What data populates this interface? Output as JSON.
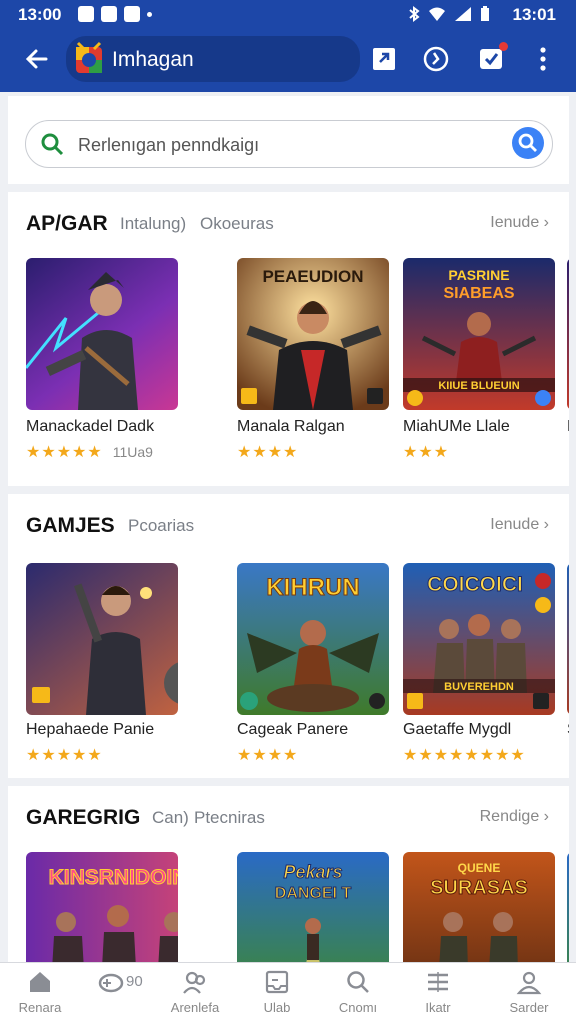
{
  "status_bar": {
    "time_left": "13:00",
    "time_right": "13:01"
  },
  "app_bar": {
    "title": "Imhagan"
  },
  "search": {
    "placeholder": "Rerlenıgan penndkaigı"
  },
  "sections": [
    {
      "title": "AP/GAR",
      "tabs": [
        "Intalung)",
        "Okoeuras"
      ],
      "more": "Ienude",
      "items": [
        {
          "name": "Manackadel Dadk",
          "stars": "★★★★★",
          "extra": "11Ua9"
        },
        {
          "name": "Manala Ralgan",
          "stars": "★★★★",
          "extra": ""
        },
        {
          "name": "MiahUMe Llale",
          "stars": "★★★",
          "extra": ""
        }
      ],
      "peek_label": "K"
    },
    {
      "title": "GAMJES",
      "tabs": [
        "Pcoarias"
      ],
      "more": "Ienude",
      "items": [
        {
          "name": "Hepahaede Panie",
          "stars": "★★★★★",
          "extra": ""
        },
        {
          "name": "Cageak Panere",
          "stars": "★★★★",
          "extra": ""
        },
        {
          "name": "Gaetaffe Mygdl",
          "stars": "★★★★★★★★",
          "extra": ""
        }
      ],
      "peek_label": "S"
    },
    {
      "title": "GAREGRIG",
      "tabs": [
        "Can)",
        "Ptecniras"
      ],
      "more": "Rendige",
      "items": [
        {
          "name": "",
          "stars": "",
          "extra": ""
        },
        {
          "name": "",
          "stars": "",
          "extra": ""
        },
        {
          "name": "",
          "stars": "",
          "extra": ""
        }
      ],
      "peek_label": ""
    }
  ],
  "thumb_texts": {
    "s1_i2": "PEAEUDION",
    "s1_i3_a": "PASRINE",
    "s1_i3_b": "SIABEAS",
    "s1_i3_c": "KIIUE BLUEUIN",
    "s2_i2": "KIHRUN",
    "s2_i3_a": "COICOICI",
    "s2_i3_b": "BUVEREHDN",
    "s3_i1": "KINSRNIDOIN",
    "s3_i2_a": "Pekars",
    "s3_i2_b": "DANGEI T",
    "s3_i3_a": "QUENE",
    "s3_i3_b": "SURASAS"
  },
  "bottom_nav": [
    {
      "label": "Renara",
      "icon": "home-icon"
    },
    {
      "label": "",
      "icon": "gamepad-icon",
      "count": "90"
    },
    {
      "label": "Arenlefa",
      "icon": "people-icon"
    },
    {
      "label": "Ulab",
      "icon": "inbox-icon"
    },
    {
      "label": "Cnomı",
      "icon": "search-icon"
    },
    {
      "label": "Ikatr",
      "icon": "list-icon"
    },
    {
      "label": "Sarder",
      "icon": "account-icon"
    }
  ],
  "colors": {
    "appbar": "#1d47a8",
    "star": "#f3a81b",
    "search_button": "#3b82f6"
  }
}
